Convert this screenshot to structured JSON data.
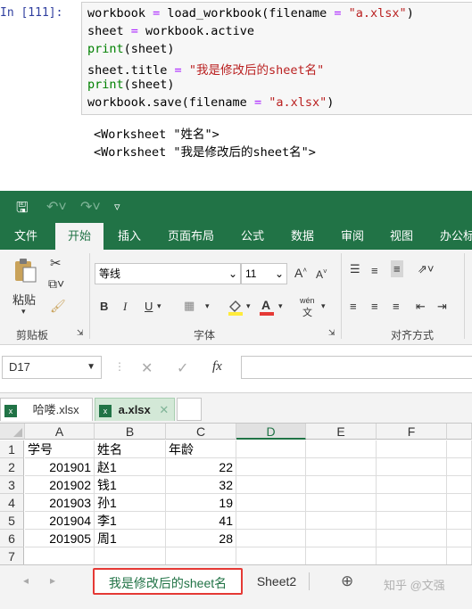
{
  "notebook": {
    "prompt": "In [111]:",
    "code": [
      [
        {
          "t": "workbook ",
          "c": ""
        },
        {
          "t": "=",
          "c": "op"
        },
        {
          "t": " load_workbook(filename ",
          "c": ""
        },
        {
          "t": "=",
          "c": "op"
        },
        {
          "t": " ",
          "c": ""
        },
        {
          "t": "\"a.xlsx\"",
          "c": "str"
        },
        {
          "t": ")",
          "c": ""
        }
      ],
      [
        {
          "t": "sheet ",
          "c": ""
        },
        {
          "t": "=",
          "c": "op"
        },
        {
          "t": " workbook.active",
          "c": ""
        }
      ],
      [
        {
          "t": "print",
          "c": "kw"
        },
        {
          "t": "(sheet)",
          "c": ""
        }
      ],
      [
        {
          "t": "sheet.title ",
          "c": ""
        },
        {
          "t": "=",
          "c": "op"
        },
        {
          "t": " ",
          "c": ""
        },
        {
          "t": "\"我是修改后的sheet名\"",
          "c": "str"
        }
      ],
      [
        {
          "t": "print",
          "c": "kw"
        },
        {
          "t": "(sheet)",
          "c": ""
        }
      ],
      [
        {
          "t": "workbook.save(filename ",
          "c": ""
        },
        {
          "t": "=",
          "c": "op"
        },
        {
          "t": " ",
          "c": ""
        },
        {
          "t": "\"a.xlsx\"",
          "c": "str"
        },
        {
          "t": ")",
          "c": ""
        }
      ]
    ],
    "output": [
      "<Worksheet \"姓名\">",
      "<Worksheet \"我是修改后的sheet名\">"
    ]
  },
  "excel": {
    "menu": [
      "文件",
      "开始",
      "插入",
      "页面布局",
      "公式",
      "数据",
      "审阅",
      "视图",
      "办公标签"
    ],
    "active_menu": "开始",
    "ribbon": {
      "paste_label": "粘贴",
      "clipboard_label": "剪贴板",
      "font_name": "等线",
      "font_size": "11",
      "font_group_label": "字体",
      "align_group_label": "对齐方式",
      "bold": "B",
      "italic": "I",
      "underline": "U",
      "grow": "A",
      "shrink": "A",
      "phonetic": "wén"
    },
    "name_box": "D17",
    "fx": "fx",
    "workbook_tabs": [
      "哈喽.xlsx",
      "a.xlsx"
    ],
    "columns": [
      "A",
      "B",
      "C",
      "D",
      "E",
      "F"
    ],
    "selected_column": "D",
    "rows": [
      [
        "学号",
        "姓名",
        "年龄"
      ],
      [
        "201901",
        "赵1",
        "22"
      ],
      [
        "201902",
        "钱1",
        "32"
      ],
      [
        "201903",
        "孙1",
        "19"
      ],
      [
        "201904",
        "李1",
        "41"
      ],
      [
        "201905",
        "周1",
        "28"
      ],
      [
        "",
        "",
        ""
      ]
    ],
    "row_numbers": [
      "1",
      "2",
      "3",
      "4",
      "5",
      "6",
      "7"
    ],
    "sheets": [
      "我是修改后的sheet名",
      "Sheet2"
    ],
    "active_sheet": "我是修改后的sheet名",
    "watermark": "知乎 @文强",
    "colors": {
      "excel_green": "#217346",
      "active_sheet_text": "#217346",
      "highlight_box": "#e53935"
    }
  }
}
